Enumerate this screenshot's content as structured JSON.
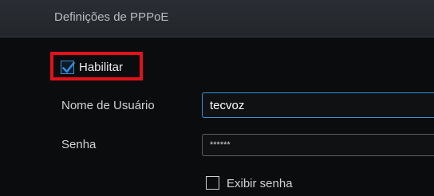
{
  "header": {
    "title": "Definições de PPPoE"
  },
  "enable": {
    "label": "Habilitar",
    "checked": true
  },
  "username": {
    "label": "Nome de Usuário",
    "value": "tecvoz"
  },
  "password": {
    "label": "Senha",
    "value": "******"
  },
  "show_password": {
    "label": "Exibir senha",
    "checked": false
  },
  "colors": {
    "accent": "#3d8fd6",
    "highlight": "#e3111a",
    "background": "#0b0c0e",
    "header": "#262930"
  },
  "icons": {
    "enable_checkbox": "checkmark-icon"
  }
}
